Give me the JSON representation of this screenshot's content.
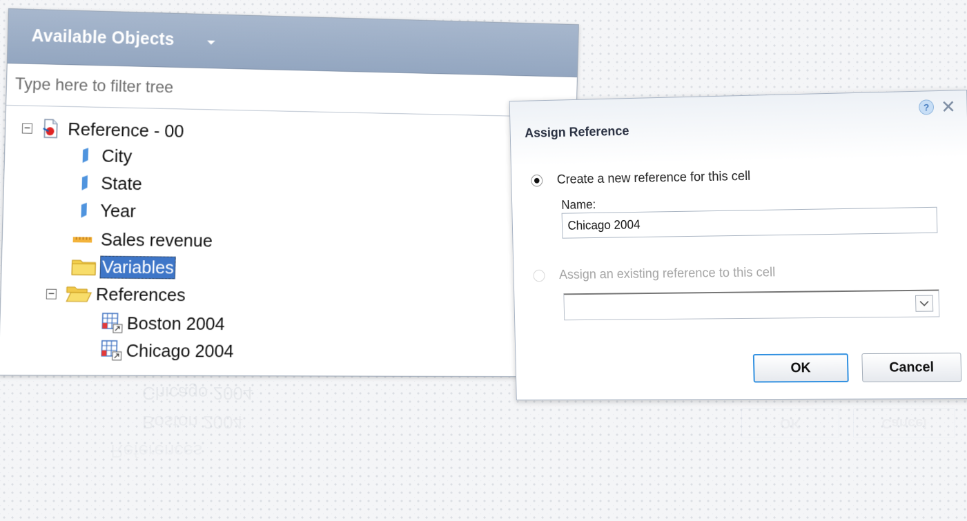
{
  "panel": {
    "title": "Available Objects",
    "collapse_glyph": "«",
    "filter_placeholder": "Type here to filter tree",
    "tree": {
      "root": {
        "label": "Reference - 00",
        "icon": "document-icon"
      },
      "dimensions": [
        {
          "label": "City",
          "icon": "dimension-icon"
        },
        {
          "label": "State",
          "icon": "dimension-icon"
        },
        {
          "label": "Year",
          "icon": "dimension-icon"
        }
      ],
      "measure": {
        "label": "Sales revenue",
        "icon": "measure-icon"
      },
      "variables": {
        "label": "Variables",
        "icon": "folder-icon"
      },
      "references": {
        "label": "References",
        "icon": "open-folder-icon",
        "items": [
          {
            "label": "Boston 2004",
            "icon": "reference-cell-icon"
          },
          {
            "label": "Chicago 2004",
            "icon": "reference-cell-icon"
          }
        ]
      }
    }
  },
  "dialog": {
    "title": "Assign Reference",
    "help_glyph": "?",
    "close_glyph": "✕",
    "option_new": "Create a new reference for this cell",
    "name_label": "Name:",
    "name_value": "Chicago 2004",
    "option_existing": "Assign an existing reference to this cell",
    "select_value": "",
    "ok_label": "OK",
    "cancel_label": "Cancel"
  },
  "colors": {
    "panel_header": "#9aaec8",
    "selection": "#3e76c8",
    "ok_focus": "#2f8fe0"
  }
}
